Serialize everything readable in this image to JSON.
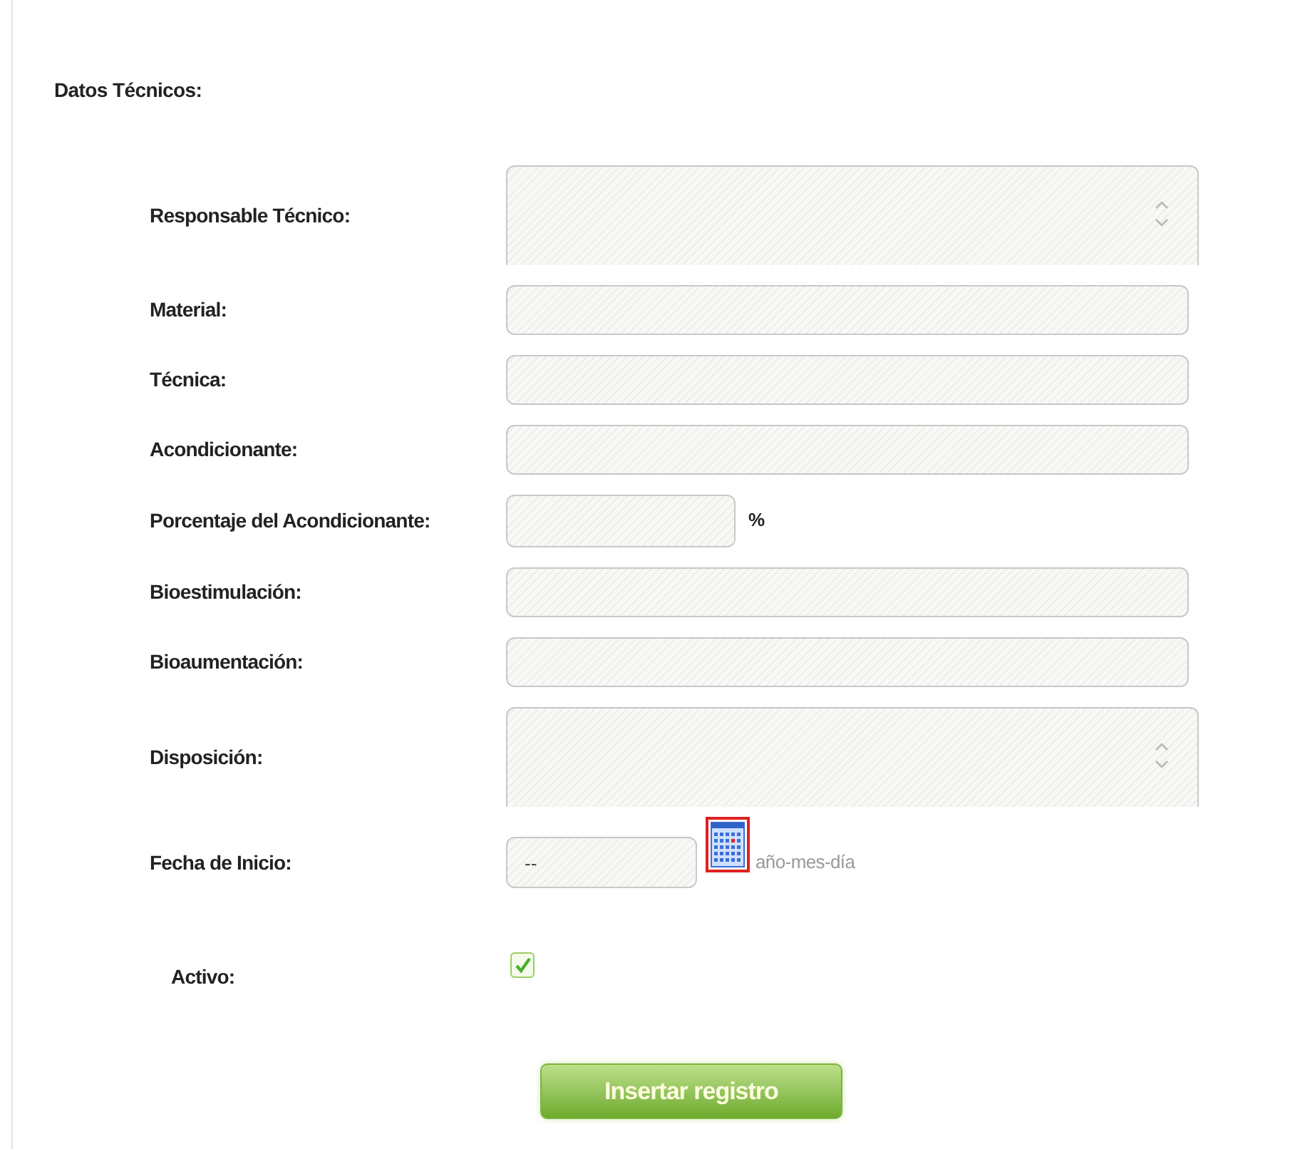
{
  "section_title": "Datos Técnicos:",
  "fields": [
    {
      "label": "Responsable Técnico:",
      "kind": "textarea"
    },
    {
      "label": "Material:",
      "kind": "text"
    },
    {
      "label": "Técnica:",
      "kind": "text"
    },
    {
      "label": "Acondicionante:",
      "kind": "text"
    },
    {
      "label": "Porcentaje del Acondicionante:",
      "kind": "number",
      "unit": "%"
    },
    {
      "label": "Bioestimulación:",
      "kind": "text"
    },
    {
      "label": "Bioaumentación:",
      "kind": "text"
    },
    {
      "label": "Disposición:",
      "kind": "textarea"
    },
    {
      "label": "Fecha de Inicio:",
      "kind": "date",
      "value": "--",
      "format_hint": "año-mes-día"
    }
  ],
  "active": {
    "label": "Activo:",
    "checked": true
  },
  "submit_button": "Insertar registro"
}
